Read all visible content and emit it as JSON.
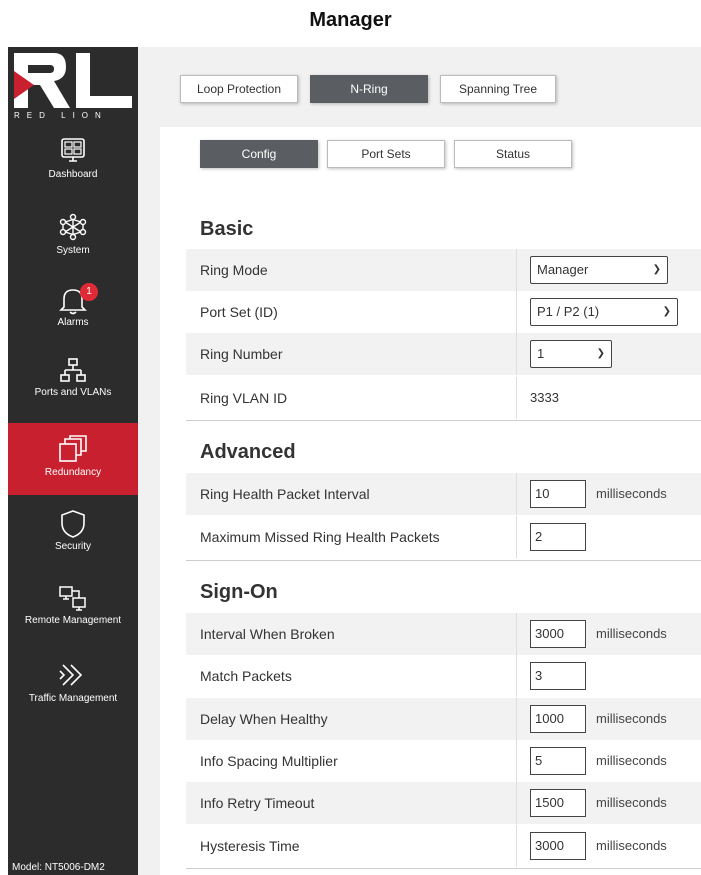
{
  "page": {
    "title": "Manager"
  },
  "brand": {
    "logo_text": "RED LION"
  },
  "sidebar": {
    "items": [
      {
        "label": "Dashboard"
      },
      {
        "label": "System"
      },
      {
        "label": "Alarms",
        "badge": "1"
      },
      {
        "label": "Ports and VLANs"
      },
      {
        "label": "Redundancy"
      },
      {
        "label": "Security"
      },
      {
        "label": "Remote Management"
      },
      {
        "label": "Traffic Management"
      }
    ],
    "model": "Model: NT5006-DM2"
  },
  "top_tabs": [
    "Loop Protection",
    "N-Ring",
    "Spanning Tree"
  ],
  "sub_tabs": [
    "Config",
    "Port Sets",
    "Status"
  ],
  "basic": {
    "title": "Basic",
    "rows": [
      {
        "label": "Ring Mode",
        "value": "Manager"
      },
      {
        "label": "Port Set (ID)",
        "value": "P1 / P2 (1)"
      },
      {
        "label": "Ring Number",
        "value": "1"
      },
      {
        "label": "Ring VLAN ID",
        "value": "3333"
      }
    ]
  },
  "advanced": {
    "title": "Advanced",
    "rows": [
      {
        "label": "Ring Health Packet Interval",
        "value": "10",
        "unit": "milliseconds"
      },
      {
        "label": "Maximum Missed Ring Health Packets",
        "value": "2"
      }
    ]
  },
  "signon": {
    "title": "Sign-On",
    "rows": [
      {
        "label": "Interval When Broken",
        "value": "3000",
        "unit": "milliseconds"
      },
      {
        "label": "Match Packets",
        "value": "3"
      },
      {
        "label": "Delay When Healthy",
        "value": "1000",
        "unit": "milliseconds"
      },
      {
        "label": "Info Spacing Multiplier",
        "value": "5",
        "unit": "milliseconds"
      },
      {
        "label": "Info Retry Timeout",
        "value": "1500",
        "unit": "milliseconds"
      },
      {
        "label": "Hysteresis Time",
        "value": "3000",
        "unit": "milliseconds"
      }
    ]
  },
  "colors": {
    "accent": "#c8202f",
    "sidebar": "#2c2c2c",
    "active_tab": "#5a5d61"
  }
}
